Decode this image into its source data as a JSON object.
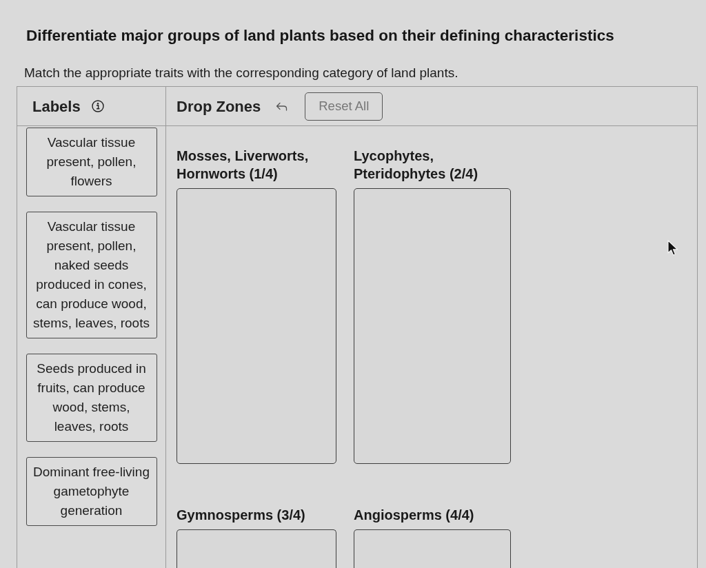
{
  "title": "Differentiate major groups of land plants based on their defining characteristics",
  "instructions": "Match the appropriate traits with the corresponding category of land plants.",
  "labels_panel": {
    "heading": "Labels"
  },
  "drop_zones_panel": {
    "heading": "Drop Zones",
    "reset_button": {
      "label": "Reset All",
      "disabled": true
    }
  },
  "labels": [
    "Vascular tissue present, pollen, flowers",
    "Vascular tissue present, pollen, naked seeds produced in cones, can produce wood, stems, leaves, roots",
    "Seeds produced in fruits, can produce wood, stems, leaves, roots",
    "Dominant free-living gametophyte generation"
  ],
  "drop_zones": [
    {
      "title": "Mosses, Liverworts, Hornworts (1/4)"
    },
    {
      "title": "Lycophytes, Pteridophytes (2/4)"
    },
    {
      "title": "Gymnosperms (3/4)"
    },
    {
      "title": "Angiosperms (4/4)"
    }
  ]
}
